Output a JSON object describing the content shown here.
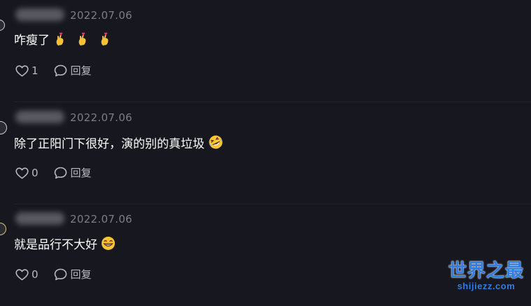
{
  "comments": [
    {
      "date": "2022.07.06",
      "text": "咋瘦了",
      "emojis": [
        "🫰",
        "🫰",
        "🫰"
      ],
      "likes": "1",
      "reply_label": "回复"
    },
    {
      "date": "2022.07.06",
      "text": "除了正阳门下很好，演的别的真垃圾",
      "emojis": [
        "🤣"
      ],
      "likes": "0",
      "reply_label": "回复"
    },
    {
      "date": "2022.07.06",
      "text": "就是品行不大好",
      "emojis": [
        "😁"
      ],
      "likes": "0",
      "reply_label": "回复"
    }
  ],
  "watermark": {
    "title": "世界之最",
    "url": "shijiezz.com"
  }
}
